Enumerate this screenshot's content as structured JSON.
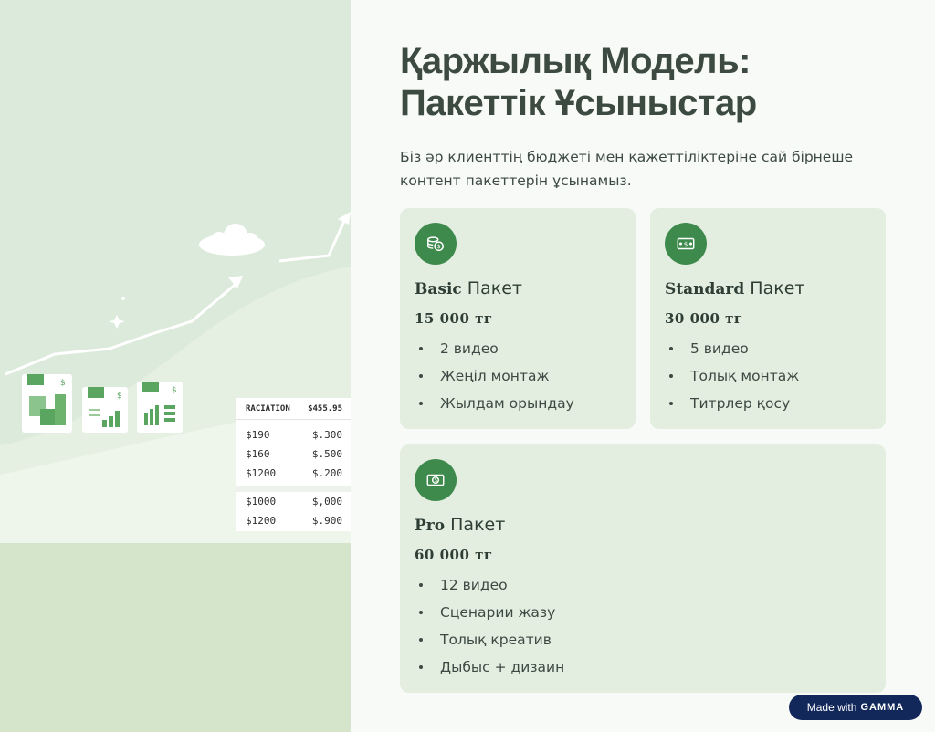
{
  "title_line1": "Қаржылық Модель:",
  "title_line2": "Пакеттік Ұсыныстар",
  "subtitle": "Біз әр клиенттің бюджеті мен қажеттіліктеріне сай бірнеше контент пакеттерін ұсынамыз.",
  "illustration": {
    "table": {
      "header": [
        "RACIATION",
        "$455.95"
      ],
      "rows": [
        [
          "$190",
          "$.300"
        ],
        [
          "$160",
          "$.500"
        ],
        [
          "$1200",
          "$.200"
        ],
        [
          "$1000",
          "$,000"
        ],
        [
          "$1200",
          "$.900"
        ]
      ]
    },
    "colors": {
      "accent": "#3e8a4c",
      "bg": "#dceadb"
    }
  },
  "packages": {
    "basic": {
      "icon": "coins-icon",
      "name_bold": "Basic",
      "name_rest": " Пакет",
      "price": "15 000 тг",
      "items": [
        "2 видео",
        "Жеңіл монтаж",
        "Жылдам орындау"
      ]
    },
    "standard": {
      "icon": "banknote-icon",
      "name_bold": "Standard",
      "name_rest": " Пакет",
      "price": "30 000 тг",
      "items": [
        "5 видео",
        "Толық монтаж",
        "Титрлер қосу"
      ]
    },
    "pro": {
      "icon": "money-bill-icon",
      "name_bold": "Pro",
      "name_rest": " Пакет",
      "price": "60 000 тг",
      "items": [
        "12 видео",
        "Сценарии жазу",
        "Толық креатив",
        "Дыбыс + дизаин"
      ]
    }
  },
  "footer": {
    "made_with": "Made with",
    "brand": "GAMMA"
  },
  "colors": {
    "accent": "#3e8a4c",
    "card": "#e3eee0",
    "badge_bg": "#13285a"
  }
}
